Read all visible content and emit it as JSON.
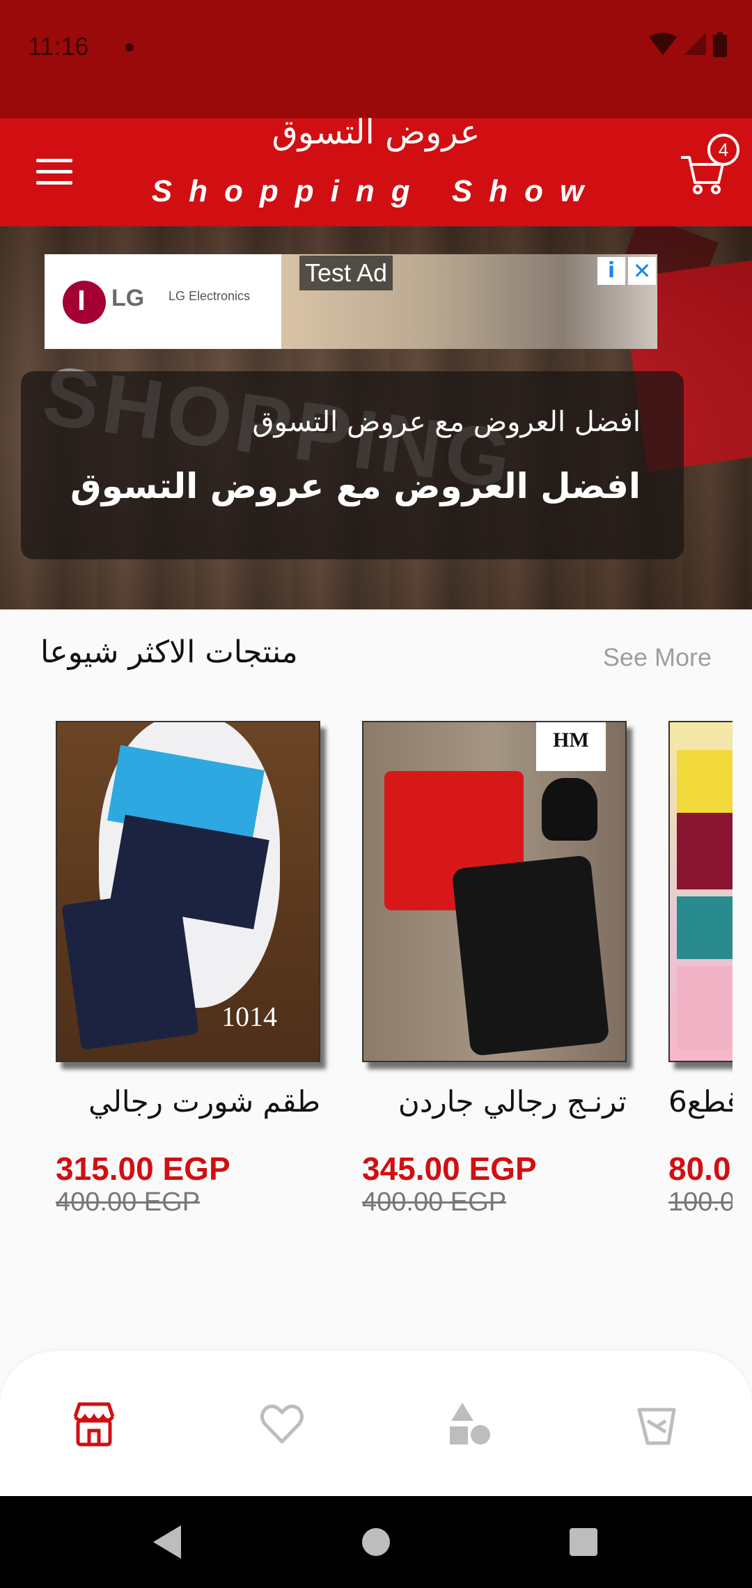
{
  "status": {
    "time": "11:16"
  },
  "app_bar": {
    "title_ar": "عروض التسوق",
    "title_en": "Shopping Show",
    "cart_count": "4"
  },
  "banner": {
    "ad": {
      "label": "Test Ad",
      "brand": "LG",
      "brand_text": "LG Electronics"
    },
    "line1": "افضل العروض مع عروض التسوق",
    "line2": "افضل العروض مع عروض التسوق"
  },
  "section": {
    "title": "منتجات الاكثر شيوعا",
    "see_more": "See More"
  },
  "products": [
    {
      "name": "طقم شورت رجالي",
      "price": "315.00 EGP",
      "old_price": "400.00  EGP",
      "image_tag": "1014"
    },
    {
      "name": "ترنـج رجالي جاردن",
      "price": "345.00 EGP",
      "old_price": "400.00  EGP",
      "image_tag": "HM"
    },
    {
      "name": "6قطع",
      "price": "80.0",
      "old_price": "100.0"
    }
  ],
  "bottom_nav": [
    {
      "icon": "store-icon",
      "active": true
    },
    {
      "icon": "heart-icon",
      "active": false
    },
    {
      "icon": "categories-icon",
      "active": false
    },
    {
      "icon": "orders-icon",
      "active": false
    }
  ],
  "colors": {
    "primary": "#d10f12",
    "status_bar": "#9b0a0a",
    "price": "#d10f12",
    "muted": "#9e9e9e"
  }
}
